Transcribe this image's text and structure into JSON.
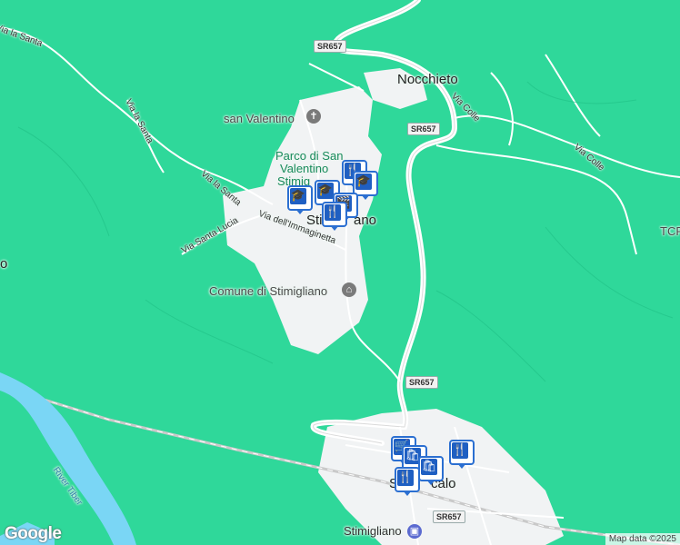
{
  "map": {
    "places": {
      "nocchieto": "Nocchieto",
      "san_valentino": "san Valentino",
      "parco_line1": "Parco di San",
      "parco_line2": "Valentino",
      "parco_line3": "Stimig",
      "stimigliano": "Sti",
      "stimigliano_tail": "ano",
      "comune": "Comune di Stimigliano",
      "stimigliano_station": "Stimigliano",
      "scalo_a": "St",
      "scalo_b": "calo",
      "left_edge": "o",
      "right_edge": "TCF"
    },
    "streets": {
      "via_la_santa_top": "Via la Santa",
      "via_la_santa_mid": "Via la Santa",
      "via_la_santa_low": "Via la Santa",
      "via_santa_lucia": "Via Santa Lucia",
      "via_immaginetta": "Via dell'Immaginetta",
      "via_colle_1": "Via Colle",
      "via_colle_2": "Via Colle",
      "river": "River Tiber"
    },
    "shields": [
      "SR657",
      "SR657",
      "SR657",
      "SR657"
    ],
    "icons": {
      "church": "church-icon",
      "townhall": "townhall-icon",
      "station": "train-station-icon",
      "school": "school-icon",
      "restaurant": "restaurant-icon",
      "shopping": "shopping-icon",
      "cinema": "cinema-icon"
    },
    "colors": {
      "land": "#2fd89a",
      "urban": "#f1f3f4",
      "river": "#7ad6f5",
      "pin": "#2b6fd1"
    }
  },
  "branding": {
    "logo": "Google",
    "attribution": "Map data ©2025"
  }
}
